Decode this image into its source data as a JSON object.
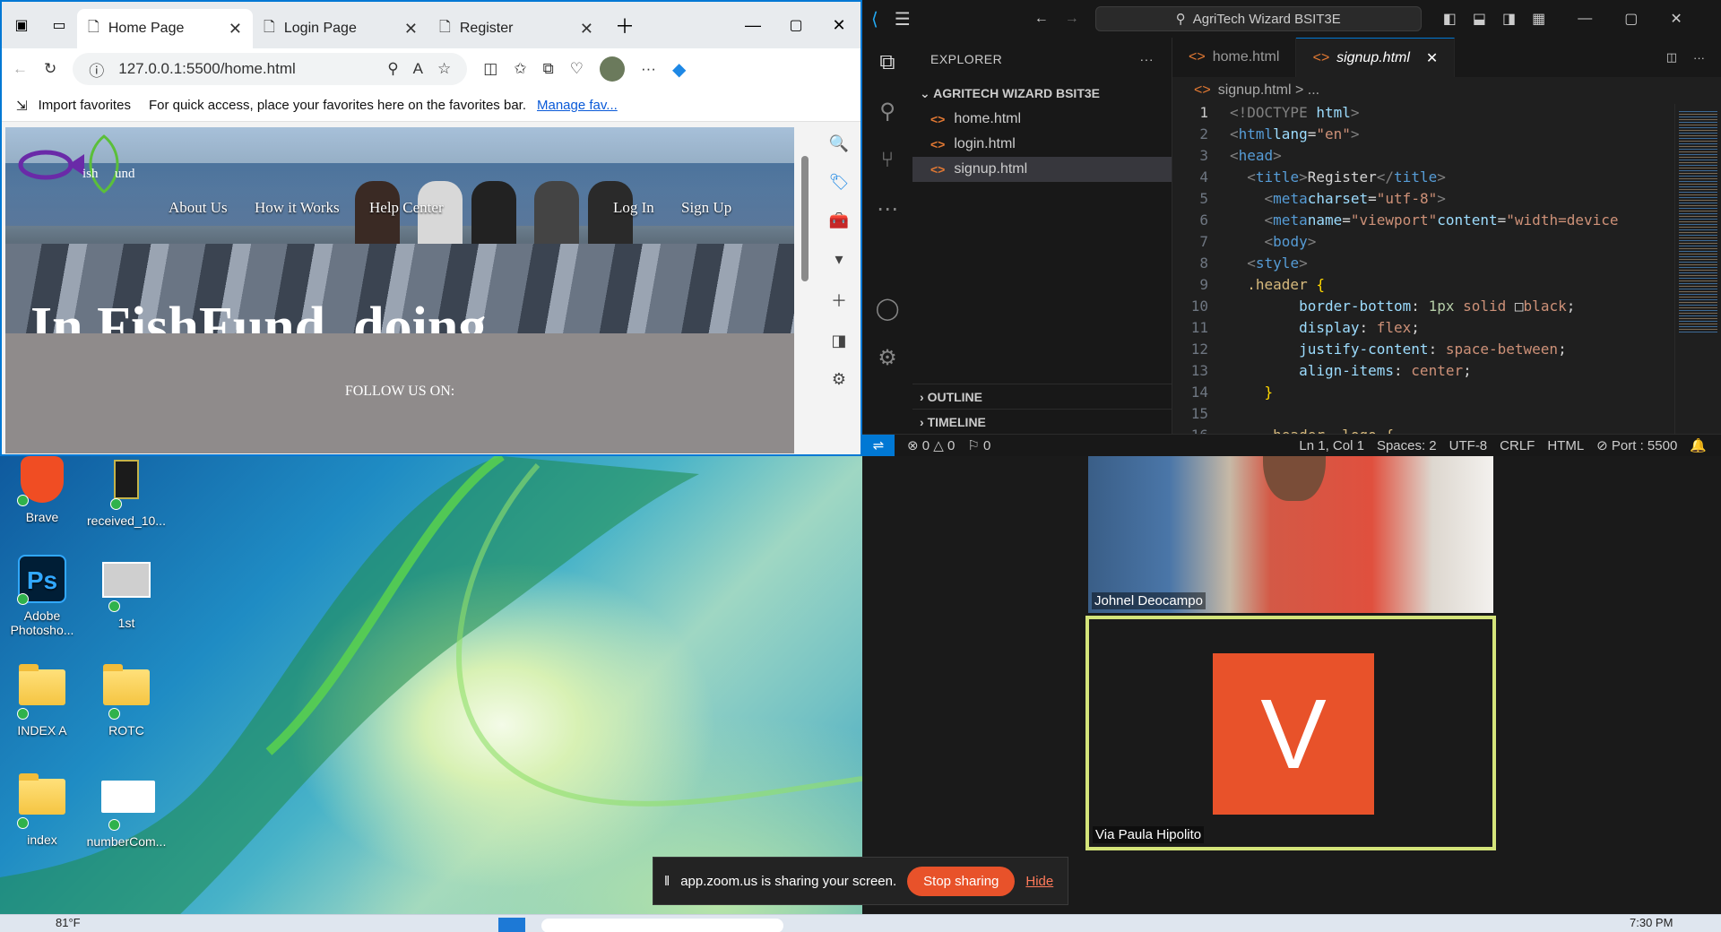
{
  "browser": {
    "tabs": [
      {
        "label": "Home Page"
      },
      {
        "label": "Login Page"
      },
      {
        "label": "Register"
      }
    ],
    "url": "127.0.0.1:5500/home.html",
    "import_favorites": "Import favorites",
    "favorites_hint": "For quick access, place your favorites here on the favorites bar.",
    "manage_link": "Manage fav..."
  },
  "site": {
    "logo_text_1": "ish",
    "logo_text_2": "und",
    "nav": [
      "About Us",
      "How it Works",
      "Help Center",
      "Log In",
      "Sign Up"
    ],
    "hero_text": "In FishFund, doing",
    "footer_text": "FOLLOW US ON:"
  },
  "desktop": {
    "icons": [
      {
        "label": "Brave"
      },
      {
        "label": "received_10..."
      },
      {
        "label": "Adobe Photosho..."
      },
      {
        "label": "1st"
      },
      {
        "label": "INDEX A"
      },
      {
        "label": "ROTC"
      },
      {
        "label": "index"
      },
      {
        "label": "numberCom..."
      }
    ],
    "weather": "81°F",
    "clock": "7:30 PM",
    "ps_letter": "Ps"
  },
  "vscode": {
    "title": "AgriTech Wizard BSIT3E",
    "explorer_label": "EXPLORER",
    "project": "AGRITECH WIZARD BSIT3E",
    "files": [
      "home.html",
      "login.html",
      "signup.html"
    ],
    "outline": "OUTLINE",
    "timeline": "TIMELINE",
    "editor_tabs": [
      "home.html",
      "signup.html"
    ],
    "breadcrumb": "signup.html > ...",
    "status": {
      "errors": "0",
      "warnings": "0",
      "ports": "0",
      "position": "Ln 1, Col 1",
      "spaces": "Spaces: 2",
      "encoding": "UTF-8",
      "eol": "CRLF",
      "lang": "HTML",
      "port": "Port : 5500"
    }
  },
  "zoom": {
    "participant_1": "Johnel Deocampo",
    "participant_2": "Via Paula Hipolito",
    "avatar_letter": "V",
    "sharing_text": "app.zoom.us is sharing your screen.",
    "stop_label": "Stop sharing",
    "hide_label": "Hide"
  },
  "colors": {
    "accent": "#0078d4",
    "zoom_orange": "#e8522a",
    "active_frame": "#d4e47a"
  }
}
